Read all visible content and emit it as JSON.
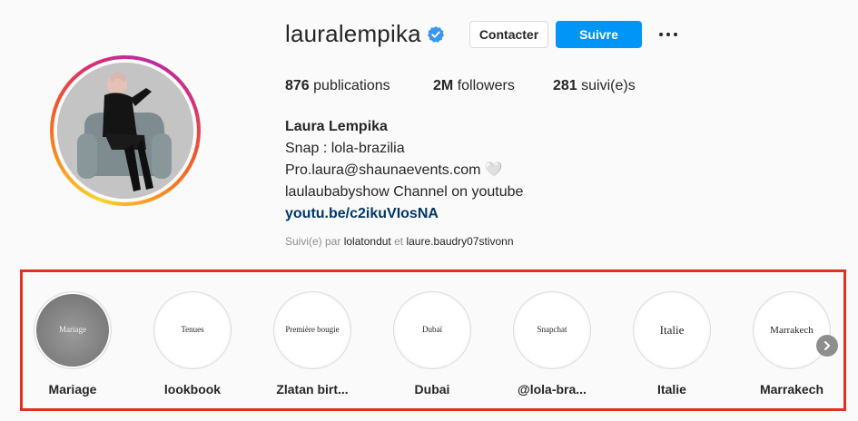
{
  "profile": {
    "username": "lauralempika",
    "verified_icon": "verified-badge-icon",
    "contact_label": "Contacter",
    "follow_label": "Suivre",
    "more_icon": "more-horizontal-icon"
  },
  "stats": {
    "posts_count": "876",
    "posts_label": "publications",
    "followers_count": "2M",
    "followers_label": "followers",
    "following_count": "281",
    "following_label": "suivi(e)s"
  },
  "bio": {
    "name": "Laura Lempika",
    "lines": [
      "Snap : lola-brazilia",
      "Pro.laura@shaunaevents.com 🤍",
      "laulaubabyshow Channel on youtube"
    ],
    "link": "youtu.be/c2ikuVIosNA"
  },
  "followed_by": {
    "prefix": "Suivi(e) par",
    "account1": "lolatondut",
    "joiner": "et",
    "account2": "laure.baudry07stivonn"
  },
  "highlights": [
    {
      "cover_text": "Mariage",
      "label": "Mariage"
    },
    {
      "cover_text": "Tenues",
      "label": "lookbook"
    },
    {
      "cover_text": "Première bougie",
      "label": "Zlatan birt..."
    },
    {
      "cover_text": "Dubaï",
      "label": "Dubai"
    },
    {
      "cover_text": "Snapchat",
      "label": "@lola-bra..."
    },
    {
      "cover_text": "Italie",
      "label": "Italie"
    },
    {
      "cover_text": "Marrakech",
      "label": "Marrakech"
    }
  ],
  "colors": {
    "accent": "#0095f6",
    "highlight_box": "#e0331f",
    "link": "#00376b"
  }
}
